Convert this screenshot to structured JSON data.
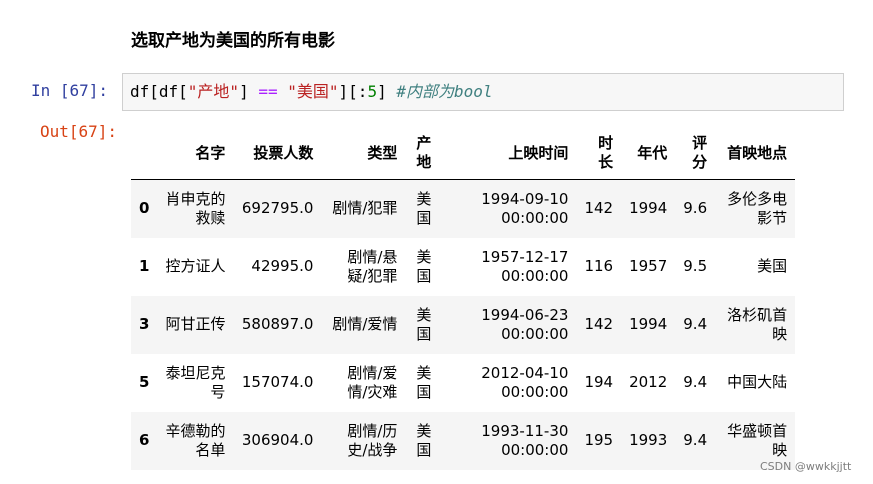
{
  "heading": "选取产地为美国的所有电影",
  "input_cell": {
    "prompt": "In  [67]:",
    "code_segments": [
      {
        "text": "df[df[",
        "cls": "c-var"
      },
      {
        "text": "\"产地\"",
        "cls": "c-str"
      },
      {
        "text": "] ",
        "cls": "c-var"
      },
      {
        "text": "==",
        "cls": "c-op"
      },
      {
        "text": " ",
        "cls": "c-var"
      },
      {
        "text": "\"美国\"",
        "cls": "c-str"
      },
      {
        "text": "][:",
        "cls": "c-var"
      },
      {
        "text": "5",
        "cls": "c-num"
      },
      {
        "text": "] ",
        "cls": "c-var"
      },
      {
        "text": "#内部为bool",
        "cls": "c-comment"
      }
    ]
  },
  "output_cell": {
    "prompt": "Out[67]:",
    "table": {
      "columns": [
        "名字",
        "投票人数",
        "类型",
        "产地",
        "上映时间",
        "时长",
        "年代",
        "评分",
        "首映地点"
      ],
      "rows": [
        {
          "index": "0",
          "cells": [
            "肖申克的救赎",
            "692795.0",
            "剧情/犯罪",
            "美国",
            "1994-09-10 00:00:00",
            "142",
            "1994",
            "9.6",
            "多伦多电影节"
          ]
        },
        {
          "index": "1",
          "cells": [
            "控方证人",
            "42995.0",
            "剧情/悬疑/犯罪",
            "美国",
            "1957-12-17 00:00:00",
            "116",
            "1957",
            "9.5",
            "美国"
          ]
        },
        {
          "index": "3",
          "cells": [
            "阿甘正传",
            "580897.0",
            "剧情/爱情",
            "美国",
            "1994-06-23 00:00:00",
            "142",
            "1994",
            "9.4",
            "洛杉矶首映"
          ]
        },
        {
          "index": "5",
          "cells": [
            "泰坦尼克号",
            "157074.0",
            "剧情/爱情/灾难",
            "美国",
            "2012-04-10 00:00:00",
            "194",
            "2012",
            "9.4",
            "中国大陆"
          ]
        },
        {
          "index": "6",
          "cells": [
            "辛德勒的名单",
            "306904.0",
            "剧情/历史/战争",
            "美国",
            "1993-11-30 00:00:00",
            "195",
            "1993",
            "9.4",
            "华盛顿首映"
          ]
        }
      ]
    }
  },
  "watermark": "CSDN @wwkkjjtt"
}
